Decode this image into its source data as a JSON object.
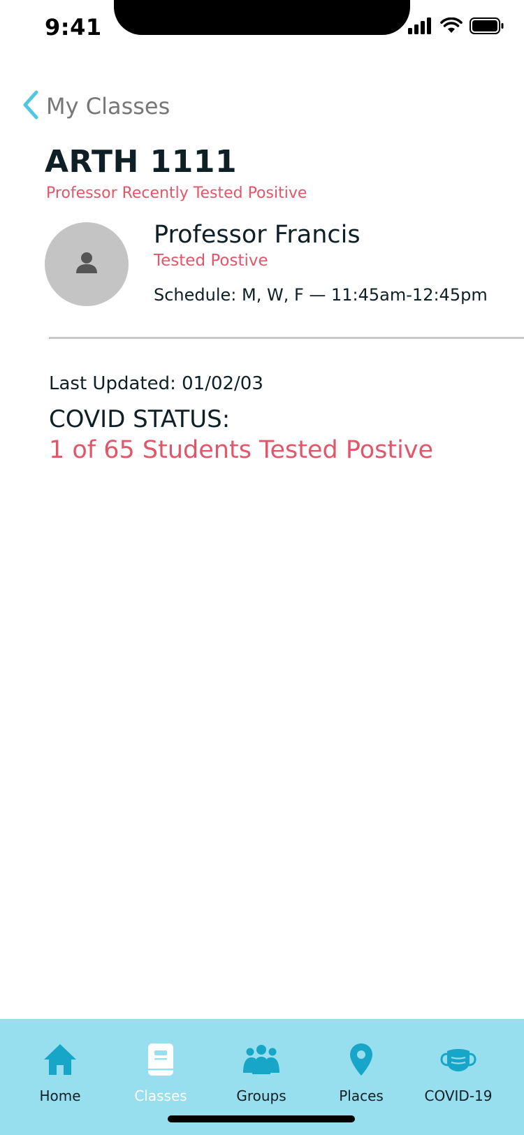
{
  "status_bar": {
    "time": "9:41",
    "icons": [
      "cellular-signal-icon",
      "wifi-icon",
      "battery-icon"
    ]
  },
  "nav": {
    "back_label": "My Classes"
  },
  "course": {
    "code": "ARTH 1111",
    "alert": "Professor Recently Tested Positive"
  },
  "professor": {
    "name": "Professor Francis",
    "status": "Tested Postive",
    "schedule": "Schedule: M, W, F — 11:45am-12:45pm"
  },
  "covid": {
    "last_updated": "Last Updated: 01/02/03",
    "heading": "COVID STATUS:",
    "value": "1 of 65 Students Tested Postive"
  },
  "tab_bar": {
    "tabs": [
      {
        "label": "Home",
        "icon": "home-icon"
      },
      {
        "label": "Classes",
        "icon": "book-icon",
        "active": true
      },
      {
        "label": "Groups",
        "icon": "group-icon"
      },
      {
        "label": "Places",
        "icon": "map-pin-icon"
      },
      {
        "label": "COVID-19",
        "icon": "face-mask-icon"
      }
    ]
  },
  "colors": {
    "accent": "#4ec8e0",
    "alert": "#e2566a",
    "tab_bar_bg": "#97dfee",
    "tab_icon": "#17a6c8"
  }
}
